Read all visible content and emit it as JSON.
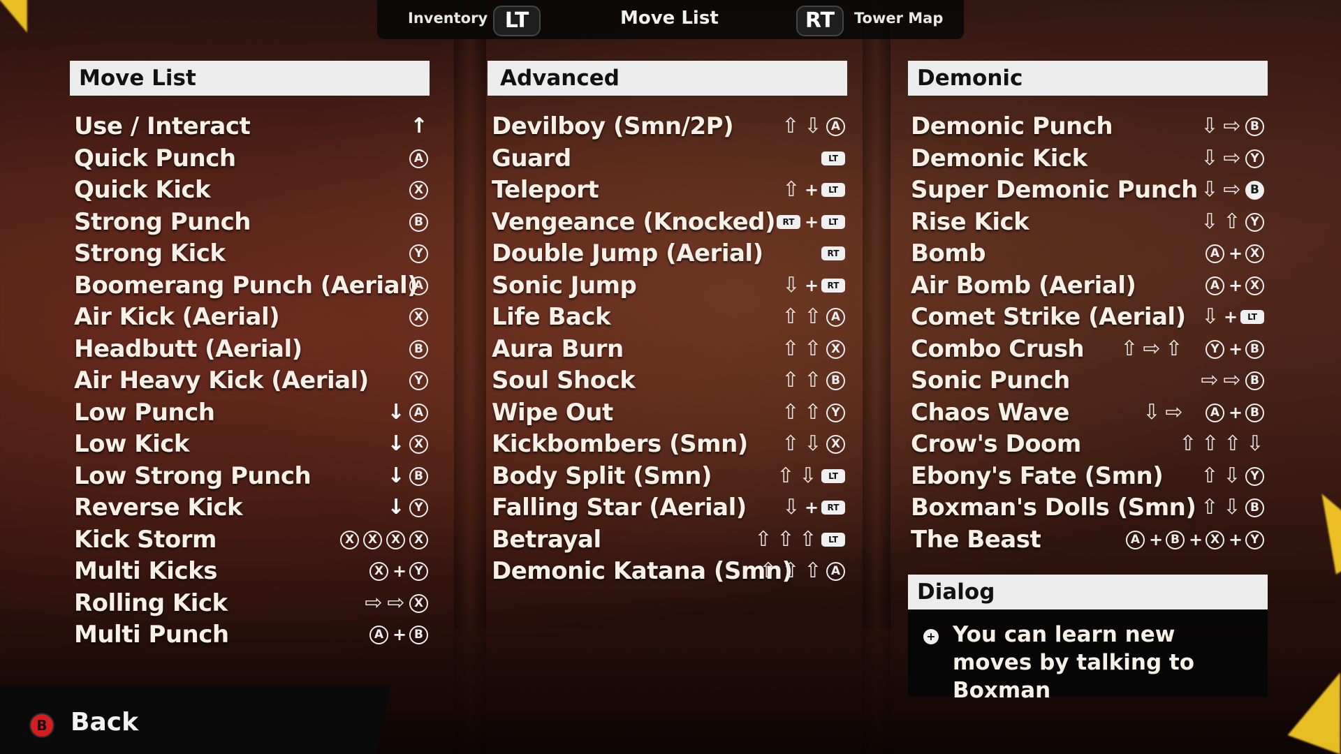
{
  "topbar": {
    "left_label": "Inventory",
    "left_trigger": "LT",
    "title": "Move List",
    "right_trigger": "RT",
    "right_label": "Tower Map"
  },
  "columns": [
    {
      "title": "Move List",
      "moves": [
        {
          "name": "Use / Interact",
          "input": [
            [
              "up-solid"
            ]
          ]
        },
        {
          "name": "Quick Punch",
          "input": [
            [
              "A"
            ]
          ]
        },
        {
          "name": "Quick Kick",
          "input": [
            [
              "X"
            ]
          ]
        },
        {
          "name": "Strong Punch",
          "input": [
            [
              "B"
            ]
          ]
        },
        {
          "name": "Strong Kick",
          "input": [
            [
              "Y"
            ]
          ]
        },
        {
          "name": "Boomerang Punch (Aerial)",
          "input": [
            [
              "A"
            ]
          ]
        },
        {
          "name": "Air Kick (Aerial)",
          "input": [
            [
              "X"
            ]
          ]
        },
        {
          "name": "Headbutt (Aerial)",
          "input": [
            [
              "B"
            ]
          ]
        },
        {
          "name": "Air Heavy Kick (Aerial)",
          "input": [
            [
              "Y"
            ]
          ]
        },
        {
          "name": "Low Punch",
          "input": [
            [
              "down-solid",
              "A"
            ]
          ]
        },
        {
          "name": "Low Kick",
          "input": [
            [
              "down-solid",
              "X"
            ]
          ]
        },
        {
          "name": "Low Strong Punch",
          "input": [
            [
              "down-solid",
              "B"
            ]
          ]
        },
        {
          "name": "Reverse Kick",
          "input": [
            [
              "down-solid",
              "Y"
            ]
          ]
        },
        {
          "name": "Kick Storm",
          "input": [
            [
              "X",
              "X",
              "X",
              "X"
            ]
          ]
        },
        {
          "name": "Multi Kicks",
          "input": [
            [
              "X",
              "+",
              "Y"
            ]
          ]
        },
        {
          "name": "Rolling Kick",
          "input": [
            [
              "right",
              "right",
              "X"
            ]
          ]
        },
        {
          "name": "Multi Punch",
          "input": [
            [
              "A",
              "+",
              "B"
            ]
          ]
        }
      ]
    },
    {
      "title": "Advanced",
      "moves": [
        {
          "name": "Devilboy (Smn/2P)",
          "input": [
            [
              "up",
              "down",
              "A"
            ]
          ]
        },
        {
          "name": "Guard",
          "input": [
            [
              "LT"
            ]
          ]
        },
        {
          "name": "Teleport",
          "input": [
            [
              "up",
              "+",
              "LT"
            ]
          ]
        },
        {
          "name": "Vengeance (Knocked)",
          "input": [
            [
              "RT",
              "+",
              "LT"
            ]
          ]
        },
        {
          "name": "Double Jump (Aerial)",
          "input": [
            [
              "RT"
            ]
          ]
        },
        {
          "name": "Sonic Jump",
          "input": [
            [
              "down",
              "+",
              "RT"
            ]
          ]
        },
        {
          "name": "Life Back",
          "input": [
            [
              "up",
              "up",
              "A"
            ]
          ]
        },
        {
          "name": "Aura Burn",
          "input": [
            [
              "up",
              "up",
              "X"
            ]
          ]
        },
        {
          "name": "Soul Shock",
          "input": [
            [
              "up",
              "up",
              "B"
            ]
          ]
        },
        {
          "name": "Wipe Out",
          "input": [
            [
              "up",
              "up",
              "Y"
            ]
          ]
        },
        {
          "name": "Kickbombers (Smn)",
          "input": [
            [
              "up",
              "down",
              "X"
            ]
          ]
        },
        {
          "name": "Body Split (Smn)",
          "input": [
            [
              "up",
              "down",
              "LT"
            ]
          ]
        },
        {
          "name": "Falling Star (Aerial)",
          "input": [
            [
              "down",
              "+",
              "RT"
            ]
          ]
        },
        {
          "name": "Betrayal",
          "input": [
            [
              "up",
              "up",
              "up",
              "LT"
            ]
          ]
        },
        {
          "name": "Demonic Katana (Smn)",
          "input": [
            [
              "up",
              "up",
              "up",
              "A"
            ]
          ]
        }
      ]
    },
    {
      "title": "Demonic",
      "moves": [
        {
          "name": "Demonic Punch",
          "input": [
            [
              "down",
              "right",
              "B"
            ]
          ]
        },
        {
          "name": "Demonic Kick",
          "input": [
            [
              "down",
              "right",
              "Y"
            ]
          ]
        },
        {
          "name": "Super Demonic Punch",
          "input": [
            [
              "down",
              "right",
              "B-filled"
            ]
          ]
        },
        {
          "name": "Rise Kick",
          "input": [
            [
              "down",
              "up",
              "Y"
            ]
          ]
        },
        {
          "name": "Bomb",
          "input": [
            [
              "A",
              "+",
              "X"
            ]
          ]
        },
        {
          "name": "Air Bomb (Aerial)",
          "input": [
            [
              "A",
              "+",
              "X"
            ]
          ]
        },
        {
          "name": "Comet Strike (Aerial)",
          "input": [
            [
              "down",
              "+",
              "LT"
            ]
          ]
        },
        {
          "name": "Combo Crush",
          "input": [
            [
              "up",
              "right",
              "up"
            ],
            [
              "Y",
              "+",
              "B"
            ]
          ]
        },
        {
          "name": "Sonic Punch",
          "input": [
            [
              "right",
              "right",
              "B"
            ]
          ]
        },
        {
          "name": "Chaos Wave",
          "input": [
            [
              "down",
              "right"
            ],
            [
              "A",
              "+",
              "B"
            ]
          ]
        },
        {
          "name": "Crow's Doom",
          "input": [
            [
              "up",
              "up",
              "up",
              "down"
            ]
          ]
        },
        {
          "name": "Ebony's Fate (Smn)",
          "input": [
            [
              "up",
              "down",
              "Y"
            ]
          ]
        },
        {
          "name": "Boxman's Dolls (Smn)",
          "input": [
            [
              "up",
              "down",
              "B"
            ]
          ]
        },
        {
          "name": "The Beast",
          "input": [
            [
              "A",
              "+",
              "B",
              "+",
              "X",
              "+",
              "Y"
            ]
          ]
        }
      ]
    }
  ],
  "dialog": {
    "title": "Dialog",
    "icon": "+",
    "text": "You can learn new moves by talking to Boxman"
  },
  "back": {
    "button": "B",
    "label": "Back"
  },
  "colors": {
    "header_bg": "#ececec",
    "panel_bg": "#060606",
    "back_button": "#d21e1e",
    "text": "#f6f0e6"
  }
}
